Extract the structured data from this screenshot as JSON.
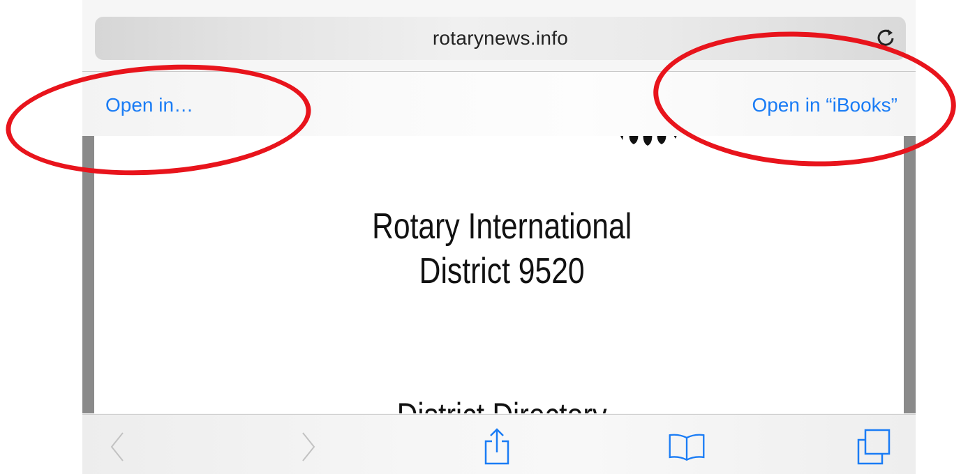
{
  "browser": {
    "url": "rotarynews.info",
    "reload_icon": "reload-icon"
  },
  "open_bar": {
    "open_in_label": "Open in…",
    "open_in_app_label": "Open in “iBooks”"
  },
  "document": {
    "title_line1": "Rotary International",
    "title_line2": "District 9520",
    "subtitle_partial": "District Directory"
  },
  "toolbar": {
    "icons": [
      "back-icon",
      "forward-icon",
      "share-icon",
      "bookmarks-icon",
      "tabs-icon"
    ]
  },
  "colors": {
    "link_blue": "#1a7cf5",
    "annotation_red": "#e8141c"
  }
}
